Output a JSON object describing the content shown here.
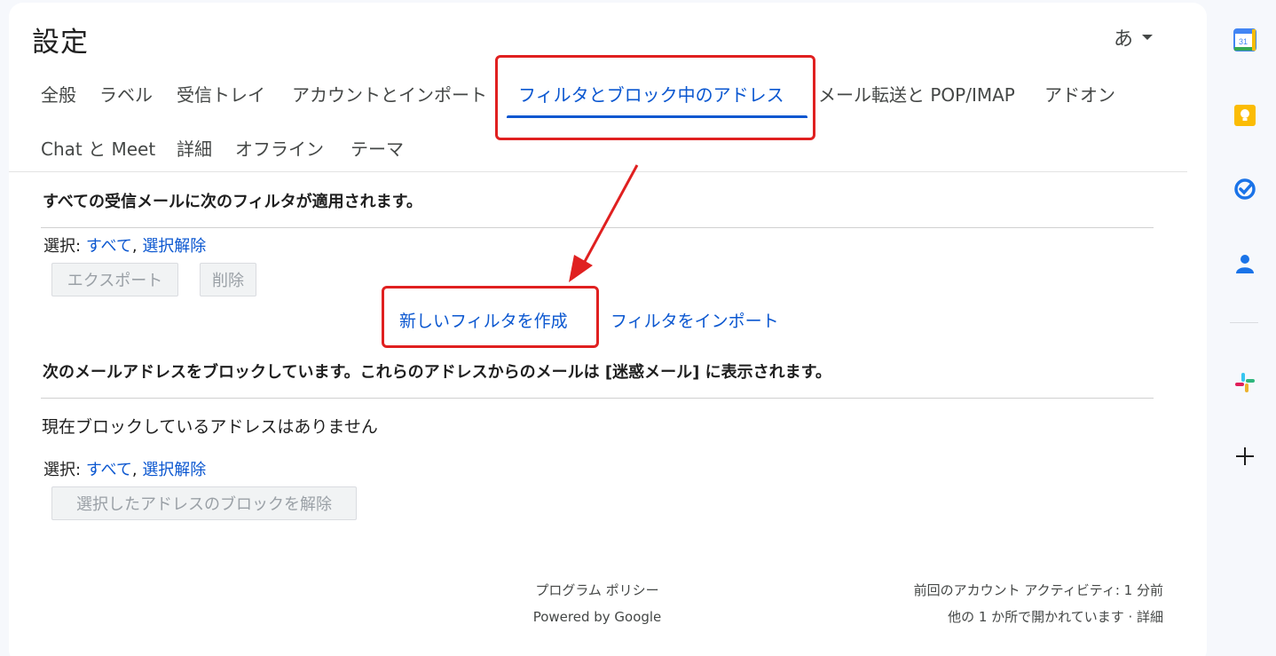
{
  "header": {
    "title": "設定",
    "lang_label": "あ"
  },
  "tabs": {
    "row1": [
      {
        "label": "全般"
      },
      {
        "label": "ラベル"
      },
      {
        "label": "受信トレイ"
      },
      {
        "label": "アカウントとインポート"
      },
      {
        "label": "フィルタとブロック中のアドレス",
        "active": true
      },
      {
        "label": "メール転送と POP/IMAP"
      },
      {
        "label": "アドオン"
      }
    ],
    "row2": [
      {
        "label": "Chat と Meet"
      },
      {
        "label": "詳細"
      },
      {
        "label": "オフライン"
      },
      {
        "label": "テーマ"
      }
    ]
  },
  "filters": {
    "heading": "すべての受信メールに次のフィルタが適用されます。",
    "select_label": "選択:",
    "select_all": "すべて",
    "comma": ",",
    "select_none": "選択解除",
    "export_button": "エクスポート",
    "delete_button": "削除",
    "create_filter_link": "新しいフィルタを作成",
    "import_filter_link": "フィルタをインポート"
  },
  "blocked": {
    "heading": "次のメールアドレスをブロックしています。これらのアドレスからのメールは [迷惑メール] に表示されます。",
    "empty_text": "現在ブロックしているアドレスはありません",
    "select_label": "選択:",
    "select_all": "すべて",
    "comma": ",",
    "select_none": "選択解除",
    "unblock_button": "選択したアドレスのブロックを解除"
  },
  "footer": {
    "program_policy": "プログラム ポリシー",
    "powered_by": "Powered by Google",
    "last_activity": "前回のアカウント アクティビティ: 1 分前",
    "open_elsewhere": "他の 1 か所で開かれています · 詳細"
  },
  "side_rail": {
    "calendar_day": "31",
    "icons": [
      "calendar-icon",
      "keep-icon",
      "tasks-icon",
      "contacts-icon",
      "slack-icon",
      "add-icon"
    ]
  },
  "colors": {
    "accent": "#0b57d0",
    "annotation": "#e02020"
  }
}
